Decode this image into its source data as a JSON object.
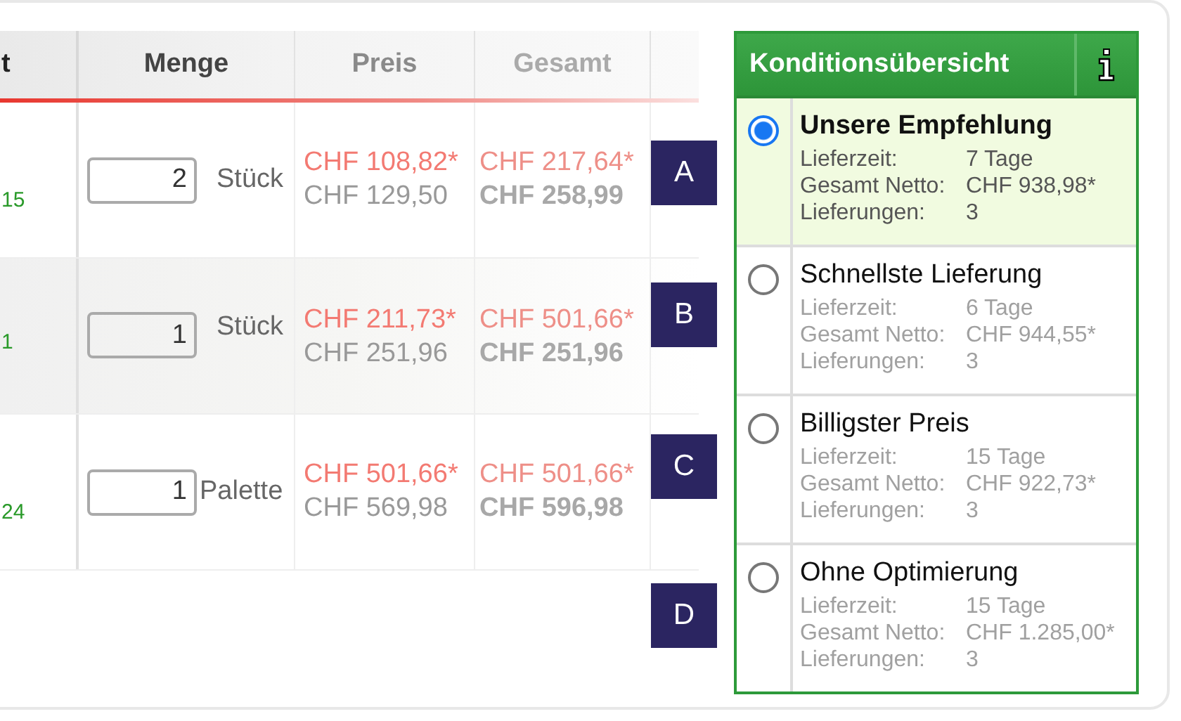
{
  "table": {
    "columns": [
      "t",
      "Menge",
      "Preis",
      "Gesamt"
    ],
    "rows": [
      {
        "column_1": "15",
        "quantity": "2",
        "unit": "Stück",
        "price_net": "CHF 108,82*",
        "price_gross": "CHF 129,50",
        "total_net": "CHF 217,64*",
        "total_gross": "CHF 258,99"
      },
      {
        "column_1": "1",
        "quantity": "1",
        "unit": "Stück",
        "price_net": "CHF 211,73*",
        "price_gross": "CHF 251,96",
        "total_net": "CHF 501,66*",
        "total_gross": "CHF 251,96"
      },
      {
        "column_1": "24",
        "quantity": "1",
        "unit": "Palette",
        "price_net": "CHF 501,66*",
        "price_gross": "CHF 569,98",
        "total_net": "CHF 501,66*",
        "total_gross": "CHF 596,98"
      }
    ]
  },
  "option_labels": [
    "A",
    "B",
    "C",
    "D"
  ],
  "panel": {
    "title": "Konditionsübersicht",
    "options": [
      {
        "title": "Unsere Empfehlung",
        "selected": true,
        "details": [
          {
            "label": "Lieferzeit:",
            "value": "7 Tage"
          },
          {
            "label": "Gesamt Netto:",
            "value": "CHF 938,98*"
          },
          {
            "label": "Lieferungen:",
            "value": "3"
          }
        ]
      },
      {
        "title": "Schnellste Lieferung",
        "selected": false,
        "details": [
          {
            "label": "Lieferzeit:",
            "value": "6 Tage"
          },
          {
            "label": "Gesamt Netto:",
            "value": "CHF 944,55*"
          },
          {
            "label": "Lieferungen:",
            "value": "3"
          }
        ]
      },
      {
        "title": "Billigster Preis",
        "selected": false,
        "details": [
          {
            "label": "Lieferzeit:",
            "value": "15 Tage"
          },
          {
            "label": "Gesamt Netto:",
            "value": "CHF 922,73*"
          },
          {
            "label": "Lieferungen:",
            "value": "3"
          }
        ]
      },
      {
        "title": "Ohne Optimierung",
        "selected": false,
        "details": [
          {
            "label": "Lieferzeit:",
            "value": "15 Tage"
          },
          {
            "label": "Gesamt Netto:",
            "value": "CHF 1.285,00*"
          },
          {
            "label": "Lieferungen:",
            "value": "3"
          }
        ]
      }
    ]
  }
}
